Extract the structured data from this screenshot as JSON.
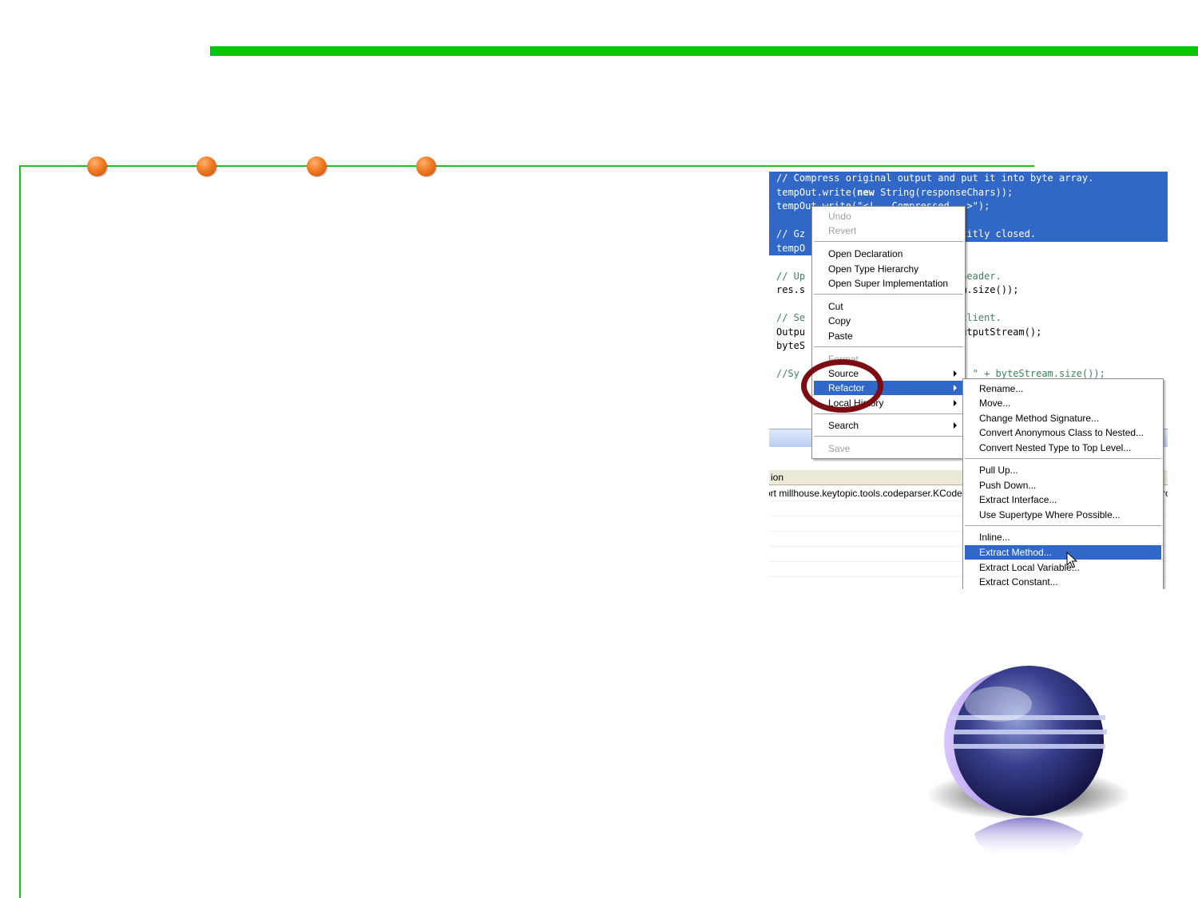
{
  "code": {
    "lines": [
      "// Compress original output and put it into byte array.",
      "tempOut.write(",
      "tempOut.write(\"<!-- Compressed -->\");",
      "",
      "// GzipOutputStream must be explicitly closed.",
      "tempOut",
      "",
      "// Update the Content-Length header.",
      "res.setContentLength(byteStream.size());",
      "",
      "// Send compressed result to client.",
      "OutputStream out = res.getOutputStream();",
      "byteStream.writeTo(out);",
      "",
      "//System.out.println(\"Compressed size : \" + byteStream.size());"
    ],
    "line2_keyword": "new",
    "line2_rest": " String(responseChars));",
    "visible": {
      "l0": "// Compress original output and put it into byte array.",
      "l1a": "tempOut.write(",
      "l1b": "new",
      "l1c": " String(responseChars));",
      "l2": "tempOut.write(\"<!-- Compressed -->\");",
      "l4": "// Gz                         licitly closed.",
      "l5": "tempO",
      "l7": "// Up                         h header.",
      "l8": "res.s                        ream.size());",
      "l10": "// Se                         o client.",
      "l11": "Outpu                       getOutputStream();",
      "l12": "byteS                       ;",
      "l14": "//Sy                         te : \" + byteStream.size());"
    }
  },
  "lower_panel": {
    "column_header": "ion",
    "row_text": "ort millhouse.keytopic.tools.codeparser.KCode",
    "row_tail": "rc"
  },
  "context_menu": {
    "items": [
      {
        "label": "Undo",
        "disabled": true
      },
      {
        "label": "Revert",
        "disabled": true
      },
      {
        "label": "Open Declaration"
      },
      {
        "label": "Open Type Hierarchy"
      },
      {
        "label": "Open Super Implementation"
      },
      {
        "label": "Cut"
      },
      {
        "label": "Copy"
      },
      {
        "label": "Paste"
      },
      {
        "label": "Format",
        "disabled": true
      },
      {
        "label": "Source"
      },
      {
        "label": "Refactor"
      },
      {
        "label": "Local History"
      },
      {
        "label": "Search"
      },
      {
        "label": "Save",
        "disabled": true
      }
    ]
  },
  "refactor_menu": {
    "items": [
      {
        "label": "Rename..."
      },
      {
        "label": "Move..."
      },
      {
        "label": "Change Method Signature..."
      },
      {
        "label": "Convert Anonymous Class to Nested..."
      },
      {
        "label": "Convert Nested Type to Top Level..."
      },
      {
        "label": "Pull Up..."
      },
      {
        "label": "Push Down..."
      },
      {
        "label": "Extract Interface..."
      },
      {
        "label": "Use Supertype Where Possible..."
      },
      {
        "label": "Inline..."
      },
      {
        "label": "Extract Method..."
      },
      {
        "label": "Extract Local Variable..."
      },
      {
        "label": "Extract Constant..."
      }
    ]
  },
  "colors": {
    "top_bar": "#00c800",
    "guide_line": "#1fc01f",
    "dot": "#f07a22",
    "selection": "#3168c8",
    "highlight_circle": "#7a0c12"
  },
  "icons": [
    "submenu-arrow-icon",
    "mouse-cursor-icon",
    "eclipse-logo-icon"
  ]
}
